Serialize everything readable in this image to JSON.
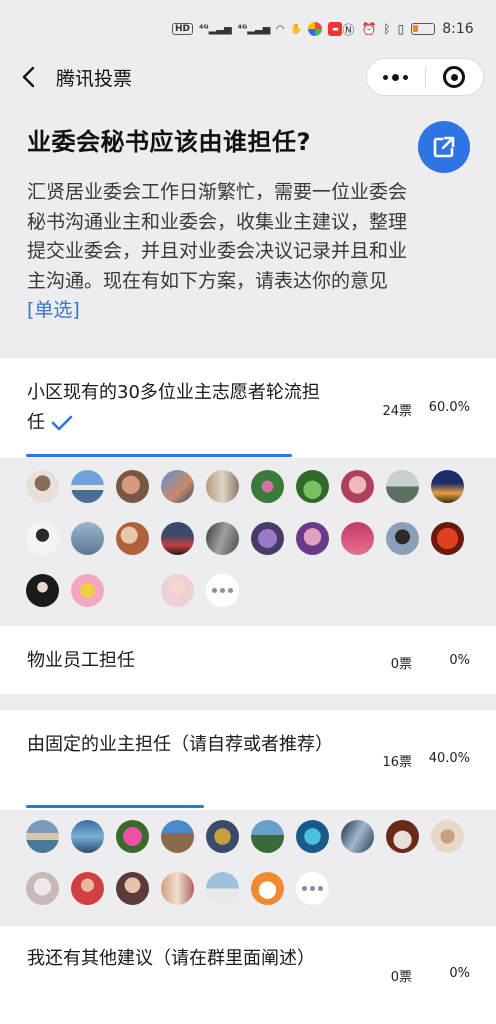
{
  "status": {
    "left_icons": [
      "HD",
      "4G",
      "4G",
      "wifi-icon",
      "hand-icon",
      "app-icon",
      "app-icon"
    ],
    "time": "8:16"
  },
  "nav": {
    "title": "腾讯投票"
  },
  "poll": {
    "title": "业委会秘书应该由谁担任?",
    "description": "汇贤居业委会工作日渐繁忙，需要一位业委会秘书沟通业主和业委会，收集业主建议，整理提交业委会，并且对业委会决议记录并且和业主沟通。现在有如下方案，请表达你的意见",
    "type_tag": "[单选]"
  },
  "options": [
    {
      "text": "小区现有的30多位业主志愿者轮流担任",
      "votes": "24票",
      "percent": "60.0%",
      "ratio": 0.6,
      "selected": true
    },
    {
      "text": "物业员工担任",
      "votes": "0票",
      "percent": "0%",
      "ratio": 0,
      "selected": false
    },
    {
      "text": "由固定的业主担任（请自荐或者推荐）",
      "votes": "16票",
      "percent": "40.0%",
      "ratio": 0.4,
      "selected": false
    },
    {
      "text": "我还有其他建议（请在群里面阐述）",
      "votes": "0票",
      "percent": "0%",
      "ratio": 0,
      "selected": false
    }
  ],
  "colors": {
    "accent": "#2f74e3",
    "tag": "#3d73d6",
    "background": "#ededf0"
  }
}
